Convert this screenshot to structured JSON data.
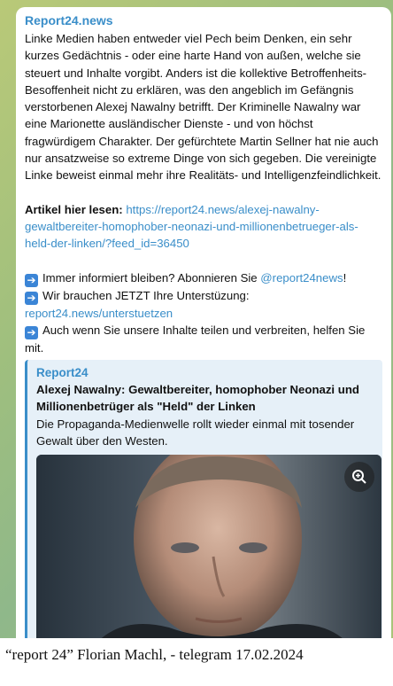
{
  "message": {
    "sender": "Report24.news",
    "paragraph": "Linke Medien haben entweder viel Pech beim Denken, ein sehr kurzes Gedächtnis - oder eine harte Hand von außen, welche sie steuert und Inhalte vorgibt. Anders ist die kollektive Betroffenheits-Besoffenheit nicht zu erklären, was den angeblich im Gefängnis verstorbenen Alexej Nawalny betrifft. Der Kriminelle Nawalny war eine Marionette ausländischer Dienste - und von höchst fragwürdigem Charakter. Der gefürchtete Martin Sellner hat nie auch nur ansatzweise so extreme Dinge von sich gegeben. Die vereinigte Linke beweist einmal mehr ihre Realitäts- und Intelligenzfeindlichkeit.",
    "article_label": "Artikel hier lesen:",
    "article_url": "https://report24.news/alexej-nawalny-gewaltbereiter-homophober-neonazi-und-millionenbetrueger-als-held-der-linken/?feed_id=36450",
    "line1_text": "Immer informiert bleiben? Abonnieren Sie ",
    "line1_link": "@report24news",
    "line1_end": "!",
    "line2_text": "Wir brauchen JETZT Ihre Unterstüzung:",
    "line2_link": "report24.news/unterstuetzen",
    "line3_text": "Auch wenn Sie unsere Inhalte teilen und verbreiten, helfen Sie mit.",
    "arrow_icon": "➡"
  },
  "preview": {
    "site": "Report24",
    "title": "Alexej Nawalny: Gewaltbereiter, homophober Neonazi und Millionenbetrüger als \"Held\" der Linken",
    "description": "Die Propaganda-Medienwelle rollt wieder einmal mit tosender Gewalt über den Westen.",
    "image_icon": "zoom-in-icon"
  },
  "caption": "“report 24”  Florian Machl, - telegram 17.02.2024"
}
